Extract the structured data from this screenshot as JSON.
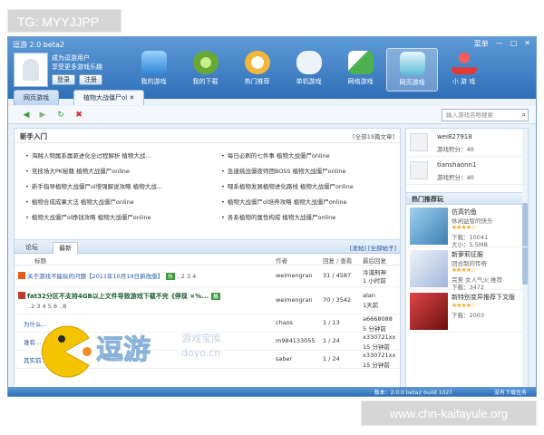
{
  "overlay": {
    "top_tag": "TG: MYYJJPP",
    "bottom_tag": "www.chn-kaifayule.org"
  },
  "window": {
    "title": "逗游 2.0 beta2",
    "controls": [
      "菜单",
      "—",
      "□",
      "✕"
    ]
  },
  "user": {
    "line1": "成为逗游用户",
    "line2": "享受更多游戏乐趣",
    "login": "登录",
    "register": "注册"
  },
  "nav": [
    {
      "label": "我的游戏",
      "icon": "game-folder-icon",
      "color": "#4da3e8"
    },
    {
      "label": "我的下载",
      "icon": "gear-icon",
      "color": "#7bc043"
    },
    {
      "label": "热门推荐",
      "icon": "search-icon",
      "color": "#f0b73a"
    },
    {
      "label": "单机游戏",
      "icon": "gamepad-icon",
      "color": "#e8eef5"
    },
    {
      "label": "网络游戏",
      "icon": "book-icon",
      "color": "#4caf50"
    },
    {
      "label": "网页游戏",
      "icon": "web-game-icon",
      "color": "#5bbad5"
    },
    {
      "label": "小 游 戏",
      "icon": "joystick-icon",
      "color": "#e53935"
    }
  ],
  "tabs": [
    {
      "label": "网页游戏"
    },
    {
      "label": "植物大战僵尸ol ✕"
    }
  ],
  "toolbar": {
    "search_placeholder": "输入游戏名称搜索"
  },
  "guide": {
    "title": "新手入门",
    "more": "[全部19篇文章]",
    "items_left": [
      "海贼人物属系属驱进化全过程解析  植物大战...",
      "竞技场大PK秘籍  植物大战僵尸online",
      "新手指导植物大战僵尸ol增强解说攻略  植物大战...",
      "植物合成成果大法  植物大战僵尸online",
      "植物大战僵尸ol挣钱攻略  植物大战僵尸online"
    ],
    "items_right": [
      "每日必刷的七件事  植物大战僵尸online",
      "急速挑战僵夜师团BOSS  植物大战僵尸online",
      "喂系植物发展植物进化路线  植物大战僵尸online",
      "植物大战僵尸ol培养攻略  植物大战僵尸online",
      "各系植物的属性构成  植物大战僵尸online"
    ]
  },
  "forum": {
    "tabs": [
      "论坛",
      "最新"
    ],
    "more": "[发帖]  [全部帖子]",
    "columns": [
      "标题",
      "作者",
      "回复 / 查看",
      "最后回复"
    ],
    "rows": [
      {
        "title": "关于游戏不能玩的问题【2011年10月19日新改版】",
        "pages": "..2 3 4",
        "author": "weimengran",
        "stats": "31 / 4587",
        "last1": "冷漠刑神",
        "last2": "1 小时前",
        "pill": "热"
      },
      {
        "title": "fat32分区不支持4GB以上文件导致游戏下载不完《停现 ×%...",
        "pages": "..2 3 4 5 6 ..8",
        "author": "weimengran",
        "stats": "70 / 3542",
        "last1": "alan",
        "last2": "1天前",
        "pill": "热"
      },
      {
        "title": "为什么...",
        "pages": "",
        "author": "chaos",
        "stats": "1 / 13",
        "last1": "a6668088",
        "last2": "5 分钟前",
        "pill": ""
      },
      {
        "title": "谁有...",
        "pages": "",
        "author": "m984133055",
        "stats": "1 / 24",
        "last1": "x330721xx",
        "last2": "15 分钟前",
        "pill": ""
      },
      {
        "title": "其实前...",
        "pages": "",
        "author": "saber",
        "stats": "1 / 24",
        "last1": "x330721xx",
        "last2": "15 分钟前",
        "pill": ""
      }
    ]
  },
  "side": {
    "users": [
      {
        "name": "wei827918",
        "score": "游戏积分：40"
      },
      {
        "name": "tianshaonn1",
        "score": "游戏积分：40"
      }
    ],
    "reco_title": "热门推荐玩",
    "games": [
      {
        "title": "仿真钓鱼",
        "desc": "休闲益智的快乐",
        "stars": "★★★★☆",
        "size1": "下载：10041",
        "size2": "大小：5.5MB",
        "thumb": "#5f9ec8"
      },
      {
        "title": "新萝莉征服",
        "desc": "回合制的传奇",
        "stars": "★★★★☆",
        "size1": "完美  女人气火  推荐",
        "size2": "下载：3472",
        "thumb": "#b7c8e6"
      },
      {
        "title": "新特别变异推荐下文版",
        "desc": "",
        "stars": "★★★★☆",
        "size1": "下载：2003",
        "size2": "",
        "thumb": "#b52626"
      }
    ]
  },
  "status": {
    "version": "版本：2.0.0 beta2 build 1027",
    "downloads": "没有下载任务"
  },
  "watermark": {
    "text": "逗游",
    "sub": "游戏宝库",
    "url": "doyo.cn"
  }
}
